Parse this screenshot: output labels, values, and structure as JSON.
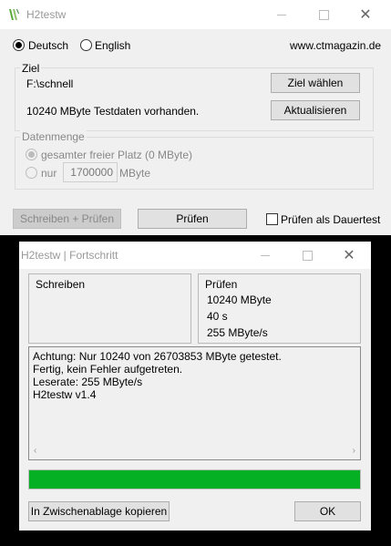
{
  "main_window": {
    "title": "H2testw",
    "language": {
      "deutsch_label": "Deutsch",
      "english_label": "English",
      "selected": "Deutsch"
    },
    "website": "www.ctmagazin.de",
    "target": {
      "group_label": "Ziel",
      "path": "F:\\schnell",
      "select_button": "Ziel wählen",
      "status": "10240 MByte Testdaten vorhanden.",
      "refresh_button": "Aktualisieren"
    },
    "data_amount": {
      "group_label": "Datenmenge",
      "all_free_label": "gesamter freier Platz (0 MByte)",
      "only_label": "nur",
      "only_value": "1700000",
      "unit": "MByte"
    },
    "write_verify_button": "Schreiben + Prüfen",
    "verify_button": "Prüfen",
    "endless_label": "Prüfen als Dauertest"
  },
  "progress_window": {
    "title": "H2testw | Fortschritt",
    "write_panel": {
      "label": "Schreiben"
    },
    "verify_panel": {
      "label": "Prüfen",
      "size": "10240 MByte",
      "time": "40 s",
      "speed": "255 MByte/s"
    },
    "log_lines": [
      "Achtung: Nur 10240 von 26703853 MByte getestet.",
      "Fertig, kein Fehler aufgetreten.",
      "Leserate: 255 MByte/s",
      "H2testw v1.4"
    ],
    "progress_percent": 100,
    "progress_color": "#06b025",
    "copy_button": "In Zwischenablage kopieren",
    "ok_button": "OK"
  }
}
